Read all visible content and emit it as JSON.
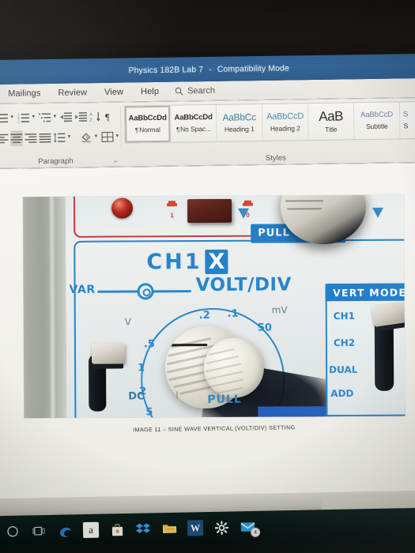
{
  "window": {
    "title": "Physics 182B Lab 7",
    "separator": "-",
    "mode": "Compatibility Mode"
  },
  "ribbon": {
    "tabs": [
      {
        "label": "s"
      },
      {
        "label": "Mailings"
      },
      {
        "label": "Review"
      },
      {
        "label": "View"
      },
      {
        "label": "Help"
      }
    ],
    "search": {
      "label": "Search",
      "icon": "search-icon"
    },
    "groups": {
      "paragraph": {
        "label": "Paragraph",
        "buttons": [
          {
            "name": "bullets",
            "icon": "bulleted-list-icon"
          },
          {
            "name": "numbering",
            "icon": "numbered-list-icon"
          },
          {
            "name": "multilevel-list",
            "icon": "multilevel-list-icon"
          },
          {
            "name": "decrease-indent",
            "icon": "decrease-indent-icon"
          },
          {
            "name": "increase-indent",
            "icon": "increase-indent-icon"
          },
          {
            "name": "sort",
            "icon": "sort-az-icon"
          },
          {
            "name": "show-formatting-marks",
            "icon": "pilcrow-icon"
          },
          {
            "name": "align-left",
            "icon": "align-left-icon"
          },
          {
            "name": "align-center",
            "icon": "align-center-icon"
          },
          {
            "name": "align-right",
            "icon": "align-right-icon"
          },
          {
            "name": "justify",
            "icon": "justify-icon"
          },
          {
            "name": "line-spacing",
            "icon": "line-spacing-icon"
          },
          {
            "name": "shading",
            "icon": "paint-bucket-icon"
          },
          {
            "name": "borders",
            "icon": "borders-grid-icon"
          }
        ],
        "selected_button": "align-center"
      },
      "styles": {
        "label": "Styles",
        "selected": "Normal",
        "items": [
          {
            "preview": "AaBbCcDd",
            "name": "Normal",
            "mark": "¶"
          },
          {
            "preview": "AaBbCcDd",
            "name": "No Spac...",
            "mark": "¶"
          },
          {
            "preview": "AaBbCc",
            "name": "Heading 1",
            "mark": ""
          },
          {
            "preview": "AaBbCcD",
            "name": "Heading 2",
            "mark": ""
          },
          {
            "preview": "AaB",
            "name": "Title",
            "mark": ""
          },
          {
            "preview": "AaBbCcD",
            "name": "Subtitle",
            "mark": ""
          }
        ]
      }
    }
  },
  "document": {
    "figure": {
      "caption": "IMAGE 11 – SINE WAVE VERTICAL (VOLT/DIV) SETTING",
      "subject": "oscilloscope-front-panel",
      "labels": {
        "channel": "CH1",
        "channel_badge": "X",
        "var": "VAR",
        "voltdiv": "VOLT/DIV",
        "unit_volts": "V",
        "unit_millivolts": "mV",
        "coupling": "DC",
        "pull_top": "PULL",
        "pull_bottom": "PULL",
        "power_on": "1",
        "power_off": "0"
      },
      "dial_markings": [
        ".5",
        "1",
        "2",
        "5",
        ".2",
        ".1",
        "50"
      ],
      "vert_mode": {
        "header": "VERT MODE",
        "options": [
          "CH1",
          "CH2",
          "DUAL",
          "ADD"
        ]
      },
      "colors": {
        "panel_blue": "#1b7fd1",
        "marking_blue": "#2089d4",
        "outline_red": "#cf3b2a",
        "led_red": "#c3291c"
      }
    }
  },
  "taskbar": {
    "items": [
      {
        "name": "cortana-search",
        "icon": "circle-icon",
        "label": ""
      },
      {
        "name": "task-view",
        "icon": "task-view-icon",
        "label": ""
      },
      {
        "name": "edge",
        "icon": "edge-icon",
        "label": "e"
      },
      {
        "name": "amazon",
        "icon": "amazon-icon",
        "label": "a"
      },
      {
        "name": "microsoft-store",
        "icon": "store-icon",
        "label": ""
      },
      {
        "name": "dropbox",
        "icon": "dropbox-icon",
        "label": ""
      },
      {
        "name": "file-explorer",
        "icon": "folder-icon",
        "label": ""
      },
      {
        "name": "word",
        "icon": "word-icon",
        "label": "W"
      },
      {
        "name": "settings",
        "icon": "gear-icon",
        "label": ""
      },
      {
        "name": "mail",
        "icon": "mail-icon",
        "label": "",
        "badge": "4"
      }
    ]
  }
}
